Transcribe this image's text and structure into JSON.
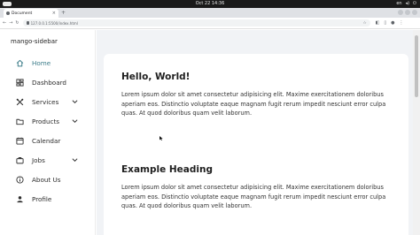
{
  "os": {
    "clock": "Oct 22  14:36",
    "tray": [
      "en",
      "◂)",
      "⏻"
    ]
  },
  "browser": {
    "tab_title": "Document",
    "url": "127.0.0.1:5500/index.html",
    "new_tab": "+",
    "close_tab": "×"
  },
  "sidebar": {
    "brand": "mango-sidebar",
    "items": [
      {
        "label": "Home",
        "icon": "home-icon",
        "active": true
      },
      {
        "label": "Dashboard",
        "icon": "dashboard-icon"
      },
      {
        "label": "Services",
        "icon": "tools-icon",
        "dropdown": true
      },
      {
        "label": "Products",
        "icon": "folder-icon",
        "dropdown": true
      },
      {
        "label": "Calendar",
        "icon": "calendar-icon"
      },
      {
        "label": "Jobs",
        "icon": "briefcase-icon",
        "dropdown": true
      },
      {
        "label": "About Us",
        "icon": "info-icon"
      },
      {
        "label": "Profile",
        "icon": "person-icon"
      }
    ]
  },
  "main": {
    "cards": [
      {
        "heading": "Hello, World!",
        "body": "Lorem ipsum dolor sit amet consectetur adipisicing elit. Maxime exercitationem doloribus aperiam eos. Distinctio voluptate eaque magnam fugit rerum impedit nesciunt error culpa quas. At quod doloribus quam velit laborum."
      },
      {
        "heading": "Example Heading",
        "body": "Lorem ipsum dolor sit amet consectetur adipisicing elit. Maxime exercitationem doloribus aperiam eos. Distinctio voluptate eaque magnam fugit rerum impedit nesciunt error culpa quas. At quod doloribus quam velit laborum."
      }
    ]
  },
  "colors": {
    "accent": "#3d7d8a",
    "content_bg": "#f1f3f6",
    "os_bar": "#1a1a1a"
  }
}
